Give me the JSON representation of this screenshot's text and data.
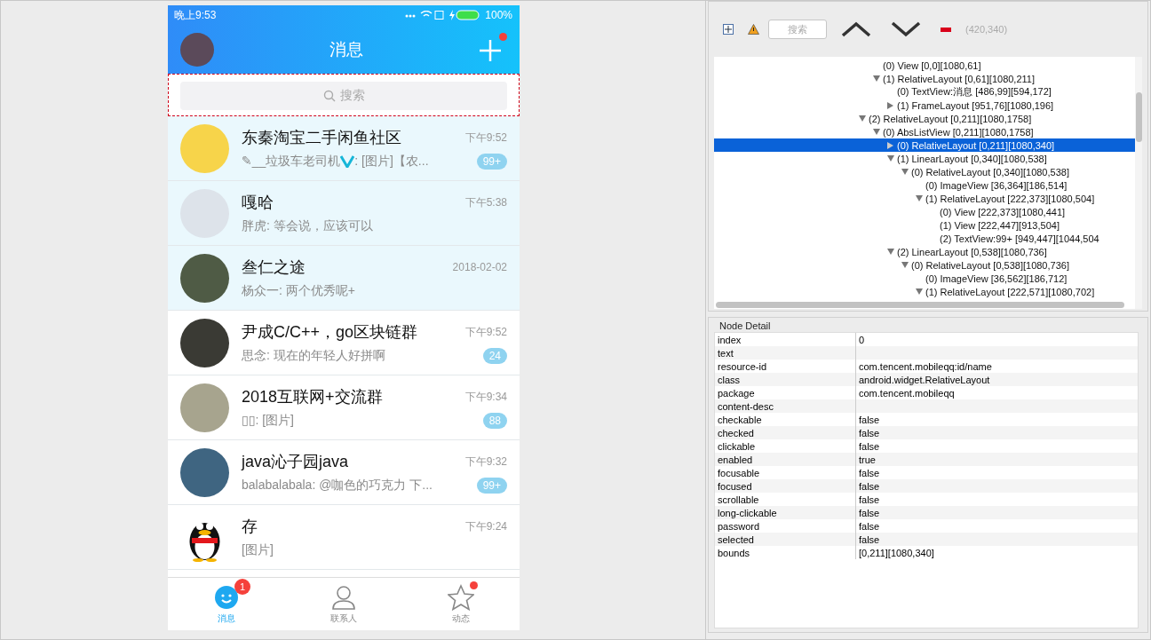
{
  "phone": {
    "status_bar": {
      "time": "晚上9:53",
      "battery": "100%"
    },
    "header": {
      "title": "消息",
      "plus_dot": true
    },
    "search": {
      "placeholder": "搜索",
      "highlighted": true
    },
    "chats": [
      {
        "name": "东秦淘宝二手闲鱼社区",
        "time": "下午9:52",
        "preview": "✎__垃圾车老司机",
        "verified": true,
        "preview_rest": ": [图片]【农...",
        "badge": "99+",
        "pinned": true,
        "kind": "photo",
        "color": "#f7d44a"
      },
      {
        "name": "嘎哈",
        "time": "下午5:38",
        "preview": "胖虎: 等会说，应该可以",
        "pinned": true,
        "kind": "photo",
        "color": "#dde3ea"
      },
      {
        "name": "叁仁之途",
        "time": "2018-02-02",
        "preview": "杨众一: 两个优秀呢+",
        "pinned": true,
        "kind": "photo",
        "color": "#4f5b45"
      },
      {
        "name": "尹成C/C++，go区块链群",
        "time": "下午9:52",
        "preview": "思念: 现在的年轻人好拼啊",
        "badge": "24",
        "pinned": false,
        "kind": "photo",
        "color": "#3a3a34"
      },
      {
        "name": "2018互联网+交流群",
        "time": "下午9:34",
        "preview": "▯▯: [图片]",
        "badge": "88",
        "pinned": false,
        "kind": "photo",
        "color": "#a7a48e"
      },
      {
        "name": "java沁子园java",
        "time": "下午9:32",
        "preview": "balabalabala: @咖色的巧克力 下...",
        "badge": "99+",
        "pinned": false,
        "kind": "photo",
        "color": "#3f6581"
      },
      {
        "name": "存",
        "time": "下午9:24",
        "preview": "[图片]",
        "pinned": false,
        "kind": "penguin"
      }
    ],
    "tabs": [
      {
        "label": "消息",
        "selected": true,
        "badge": "1",
        "kind": "chat"
      },
      {
        "label": "联系人",
        "selected": false,
        "kind": "contacts"
      },
      {
        "label": "动态",
        "selected": false,
        "dot": true,
        "kind": "star"
      }
    ]
  },
  "toolbar": {
    "search_placeholder": "搜索",
    "coords": "(420,340)"
  },
  "tree": {
    "items": [
      {
        "children": [
          {
            "label": "(0) View [0,0][1080,61]",
            "selected": false
          },
          {
            "label": "(1) RelativeLayout [0,61][1080,211]",
            "expanded": true,
            "selected": false,
            "children": [
              {
                "label": "(0) TextView:消息 [486,99][594,172]",
                "selected": false
              },
              {
                "label": "(1) FrameLayout [951,76][1080,196]",
                "expanded": false,
                "selected": false
              }
            ]
          }
        ]
      },
      {
        "label": "(2) RelativeLayout [0,211][1080,1758]",
        "expanded": true,
        "selected": false,
        "children": [
          {
            "label": "(0) AbsListView [0,211][1080,1758]",
            "expanded": true,
            "selected": false,
            "children": [
              {
                "label": "(0) RelativeLayout [0,211][1080,340]",
                "expanded": false,
                "selected": true
              },
              {
                "label": "(1) LinearLayout [0,340][1080,538]",
                "expanded": true,
                "selected": false,
                "children": [
                  {
                    "label": "(0) RelativeLayout [0,340][1080,538]",
                    "expanded": true,
                    "selected": false,
                    "children": [
                      {
                        "label": "(0) ImageView [36,364][186,514]",
                        "selected": false
                      },
                      {
                        "label": "(1) RelativeLayout [222,373][1080,504]",
                        "expanded": true,
                        "selected": false,
                        "children": [
                          {
                            "label": "(0) View [222,373][1080,441]",
                            "selected": false
                          },
                          {
                            "label": "(1) View [222,447][913,504]",
                            "selected": false
                          },
                          {
                            "label": "(2) TextView:99+ [949,447][1044,504",
                            "selected": false
                          }
                        ]
                      }
                    ]
                  }
                ]
              },
              {
                "label": "(2) LinearLayout [0,538][1080,736]",
                "expanded": true,
                "selected": false,
                "children": [
                  {
                    "label": "(0) RelativeLayout [0,538][1080,736]",
                    "expanded": true,
                    "selected": false,
                    "children": [
                      {
                        "label": "(0) ImageView [36,562][186,712]",
                        "selected": false
                      },
                      {
                        "label": "(1) RelativeLayout [222,571][1080,702]",
                        "expanded": true,
                        "selected": false
                      }
                    ]
                  }
                ]
              }
            ]
          }
        ]
      }
    ]
  },
  "node_detail": {
    "title": "Node Detail",
    "rows": [
      {
        "key": "index",
        "value": "0"
      },
      {
        "key": "text"
      },
      {
        "key": "resource-id",
        "value": "com.tencent.mobileqq:id/name"
      },
      {
        "key": "class",
        "value": "android.widget.RelativeLayout"
      },
      {
        "key": "package",
        "value": "com.tencent.mobileqq"
      },
      {
        "key": "content-desc"
      },
      {
        "key": "checkable",
        "value": "false"
      },
      {
        "key": "checked",
        "value": "false"
      },
      {
        "key": "clickable",
        "value": "false"
      },
      {
        "key": "enabled",
        "value": "true"
      },
      {
        "key": "focusable",
        "value": "false"
      },
      {
        "key": "focused",
        "value": "false"
      },
      {
        "key": "scrollable",
        "value": "false"
      },
      {
        "key": "long-clickable",
        "value": "false"
      },
      {
        "key": "password",
        "value": "false"
      },
      {
        "key": "selected",
        "value": "false"
      },
      {
        "key": "bounds",
        "value": "[0,211][1080,340]"
      }
    ]
  }
}
